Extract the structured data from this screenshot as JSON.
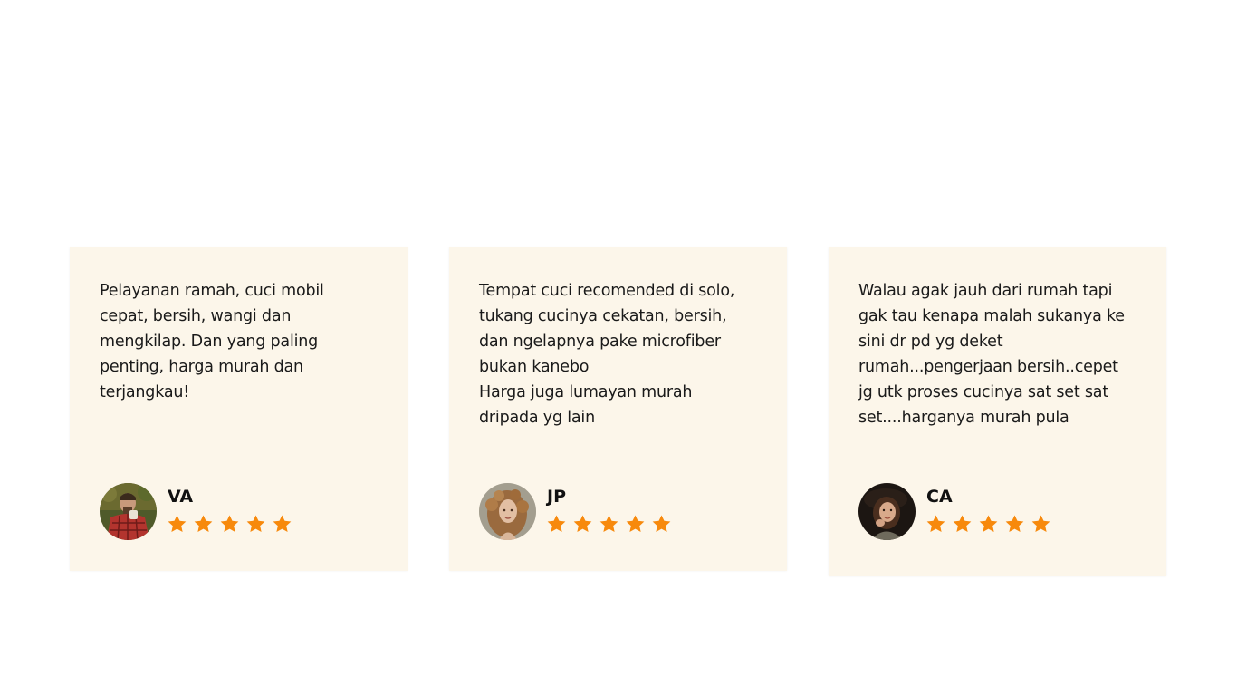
{
  "colors": {
    "card_background": "#fcf6ea",
    "star": "#f7890c",
    "text": "#1a1a1a"
  },
  "testimonials": [
    {
      "quote": "Pelayanan ramah, cuci mobil\ncepat, bersih, wangi dan\nmengkilap. Dan yang paling\npenting, harga murah dan\nterjangkau!",
      "name": "VA",
      "rating": 5,
      "avatar": "avatar-man-red-flannel"
    },
    {
      "quote": "Tempat cuci recomended di solo,\ntukang cucinya cekatan, bersih,\ndan ngelapnya pake microfiber\nbukan kanebo\nHarga juga lumayan murah\ndripada yg lain",
      "name": "JP",
      "rating": 5,
      "avatar": "avatar-woman-curly-hair"
    },
    {
      "quote": "Walau agak jauh dari rumah tapi\ngak tau kenapa malah sukanya ke\nsini dr pd yg deket\nrumah...pengerjaan bersih..cepet\njg utk proses cucinya sat set sat\nset....harganya murah pula",
      "name": "CA",
      "rating": 5,
      "avatar": "avatar-woman-hat"
    }
  ]
}
